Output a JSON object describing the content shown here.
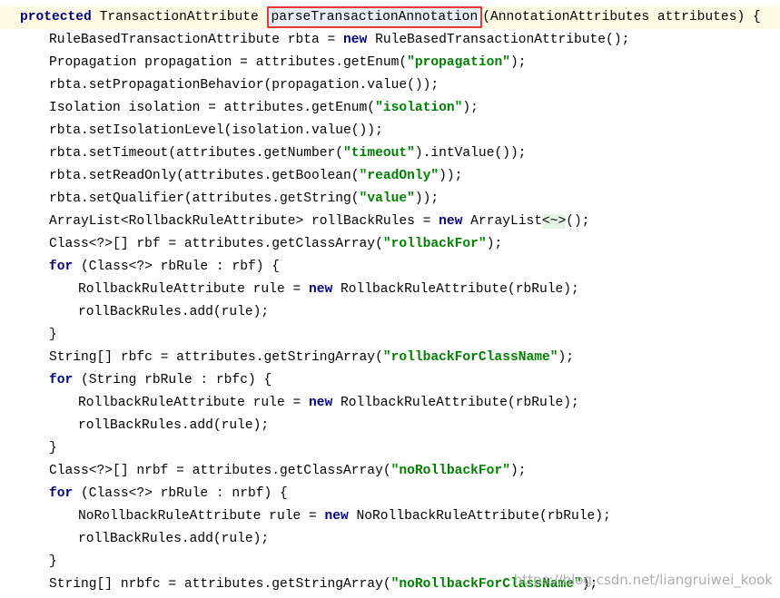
{
  "colors": {
    "background": "#ffffff",
    "current_line": "#fffae3",
    "keyword": "#000080",
    "string_literal": "#008000",
    "highlight_border": "#e53935"
  },
  "code": {
    "highlighted_identifier": "parseTransactionAnnotation",
    "lines": [
      {
        "indent": 0,
        "current": true,
        "tokens": [
          {
            "t": "protected",
            "c": "kw"
          },
          {
            "t": " TransactionAttribute ",
            "c": "plain"
          },
          {
            "t": "parseTransactionAnnotation",
            "c": "highlight"
          },
          {
            "t": "(AnnotationAttributes attributes) {",
            "c": "plain"
          }
        ]
      },
      {
        "indent": 1,
        "tokens": [
          {
            "t": "RuleBasedTransactionAttribute rbta = ",
            "c": "plain"
          },
          {
            "t": "new",
            "c": "kw"
          },
          {
            "t": " RuleBasedTransactionAttribute();",
            "c": "plain"
          }
        ]
      },
      {
        "indent": 1,
        "tokens": [
          {
            "t": "Propagation propagation = attributes.getEnum(",
            "c": "plain"
          },
          {
            "t": "\"propagation\"",
            "c": "str"
          },
          {
            "t": ");",
            "c": "plain"
          }
        ]
      },
      {
        "indent": 1,
        "tokens": [
          {
            "t": "rbta.setPropagationBehavior(propagation.value());",
            "c": "plain"
          }
        ]
      },
      {
        "indent": 1,
        "tokens": [
          {
            "t": "Isolation isolation = attributes.getEnum(",
            "c": "plain"
          },
          {
            "t": "\"isolation\"",
            "c": "str"
          },
          {
            "t": ");",
            "c": "plain"
          }
        ]
      },
      {
        "indent": 1,
        "tokens": [
          {
            "t": "rbta.setIsolationLevel(isolation.value());",
            "c": "plain"
          }
        ]
      },
      {
        "indent": 1,
        "tokens": [
          {
            "t": "rbta.setTimeout(attributes.getNumber(",
            "c": "plain"
          },
          {
            "t": "\"timeout\"",
            "c": "str"
          },
          {
            "t": ").intValue());",
            "c": "plain"
          }
        ]
      },
      {
        "indent": 1,
        "tokens": [
          {
            "t": "rbta.setReadOnly(attributes.getBoolean(",
            "c": "plain"
          },
          {
            "t": "\"readOnly\"",
            "c": "str"
          },
          {
            "t": "));",
            "c": "plain"
          }
        ]
      },
      {
        "indent": 1,
        "tokens": [
          {
            "t": "rbta.setQualifier(attributes.getString(",
            "c": "plain"
          },
          {
            "t": "\"value\"",
            "c": "str"
          },
          {
            "t": "));",
            "c": "plain"
          }
        ]
      },
      {
        "indent": 1,
        "tokens": [
          {
            "t": "ArrayList<RollbackRuleAttribute> rollBackRules = ",
            "c": "plain"
          },
          {
            "t": "new",
            "c": "kw"
          },
          {
            "t": " ArrayList",
            "c": "plain"
          },
          {
            "t": "<~>",
            "c": "diamond"
          },
          {
            "t": "();",
            "c": "plain"
          }
        ]
      },
      {
        "indent": 1,
        "tokens": [
          {
            "t": "Class<?>[] rbf = attributes.getClassArray(",
            "c": "plain"
          },
          {
            "t": "\"rollbackFor\"",
            "c": "str"
          },
          {
            "t": ");",
            "c": "plain"
          }
        ]
      },
      {
        "indent": 1,
        "tokens": [
          {
            "t": "for",
            "c": "kw"
          },
          {
            "t": " (Class<?> rbRule : rbf) {",
            "c": "plain"
          }
        ]
      },
      {
        "indent": 2,
        "tokens": [
          {
            "t": "RollbackRuleAttribute rule = ",
            "c": "plain"
          },
          {
            "t": "new",
            "c": "kw"
          },
          {
            "t": " RollbackRuleAttribute(rbRule);",
            "c": "plain"
          }
        ]
      },
      {
        "indent": 2,
        "tokens": [
          {
            "t": "rollBackRules.add(rule);",
            "c": "plain"
          }
        ]
      },
      {
        "indent": 1,
        "tokens": [
          {
            "t": "}",
            "c": "plain"
          }
        ]
      },
      {
        "indent": 1,
        "tokens": [
          {
            "t": "String[] rbfc = attributes.getStringArray(",
            "c": "plain"
          },
          {
            "t": "\"rollbackForClassName\"",
            "c": "str"
          },
          {
            "t": ");",
            "c": "plain"
          }
        ]
      },
      {
        "indent": 1,
        "tokens": [
          {
            "t": "for",
            "c": "kw"
          },
          {
            "t": " (String rbRule : rbfc) {",
            "c": "plain"
          }
        ]
      },
      {
        "indent": 2,
        "tokens": [
          {
            "t": "RollbackRuleAttribute rule = ",
            "c": "plain"
          },
          {
            "t": "new",
            "c": "kw"
          },
          {
            "t": " RollbackRuleAttribute(rbRule);",
            "c": "plain"
          }
        ]
      },
      {
        "indent": 2,
        "tokens": [
          {
            "t": "rollBackRules.add(rule);",
            "c": "plain"
          }
        ]
      },
      {
        "indent": 1,
        "tokens": [
          {
            "t": "}",
            "c": "plain"
          }
        ]
      },
      {
        "indent": 1,
        "tokens": [
          {
            "t": "Class<?>[] nrbf = attributes.getClassArray(",
            "c": "plain"
          },
          {
            "t": "\"noRollbackFor\"",
            "c": "str"
          },
          {
            "t": ");",
            "c": "plain"
          }
        ]
      },
      {
        "indent": 1,
        "tokens": [
          {
            "t": "for",
            "c": "kw"
          },
          {
            "t": " (Class<?> rbRule : nrbf) {",
            "c": "plain"
          }
        ]
      },
      {
        "indent": 2,
        "tokens": [
          {
            "t": "NoRollbackRuleAttribute rule = ",
            "c": "plain"
          },
          {
            "t": "new",
            "c": "kw"
          },
          {
            "t": " NoRollbackRuleAttribute(rbRule);",
            "c": "plain"
          }
        ]
      },
      {
        "indent": 2,
        "tokens": [
          {
            "t": "rollBackRules.add(rule);",
            "c": "plain"
          }
        ]
      },
      {
        "indent": 1,
        "tokens": [
          {
            "t": "}",
            "c": "plain"
          }
        ]
      },
      {
        "indent": 1,
        "tokens": [
          {
            "t": "String[] nrbfc = attributes.getStringArray(",
            "c": "plain"
          },
          {
            "t": "\"noRollbackForClassName\"",
            "c": "str"
          },
          {
            "t": ");",
            "c": "plain"
          }
        ]
      }
    ]
  },
  "watermark": "https://blog.csdn.net/liangruiwei_kook"
}
